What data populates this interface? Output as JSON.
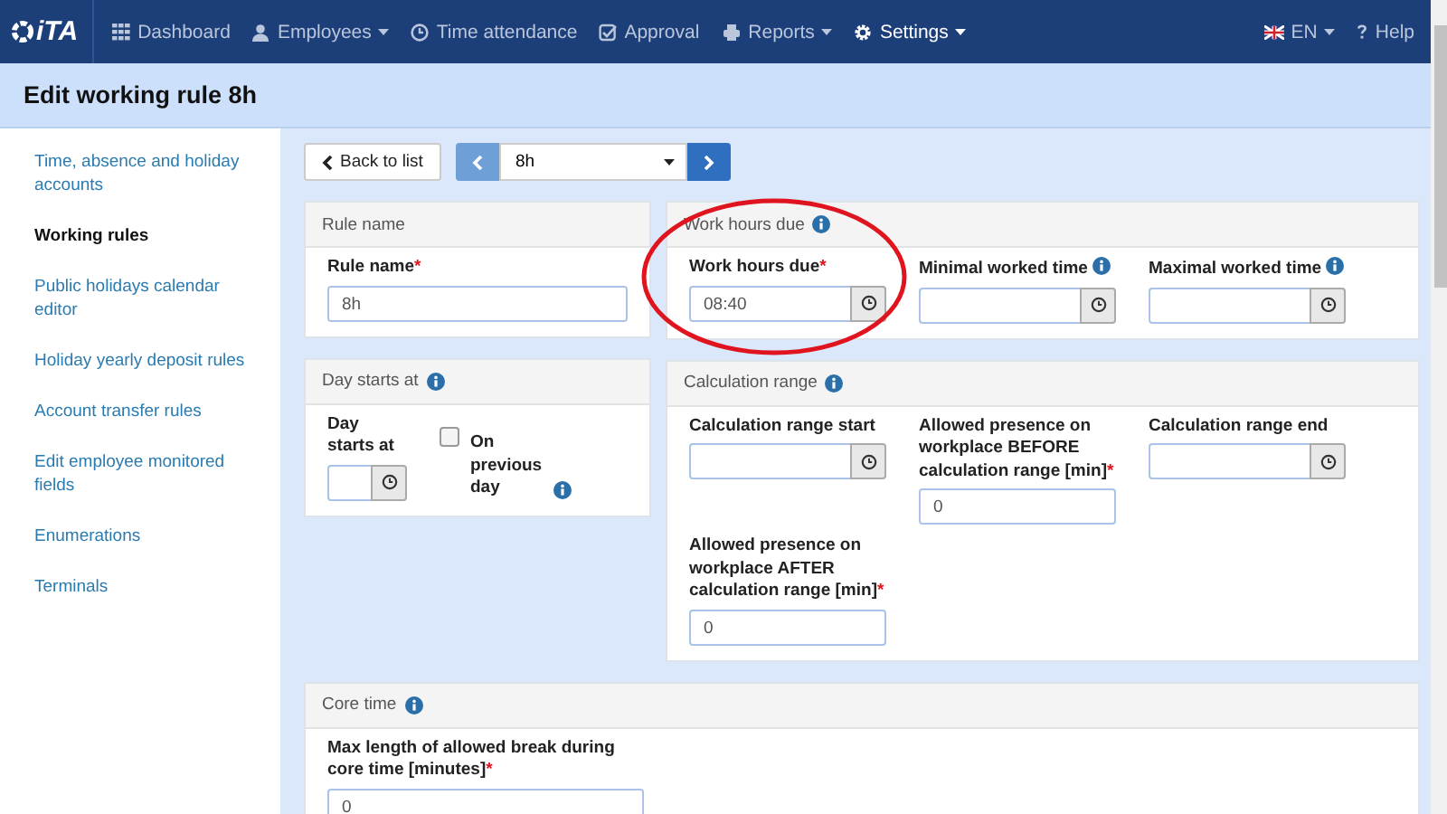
{
  "navbar": {
    "logo": "iTA",
    "items": [
      {
        "label": "Dashboard",
        "caret": false,
        "selected": false
      },
      {
        "label": "Employees",
        "caret": true,
        "selected": false
      },
      {
        "label": "Time attendance",
        "caret": false,
        "selected": false
      },
      {
        "label": "Approval",
        "caret": false,
        "selected": false
      },
      {
        "label": "Reports",
        "caret": true,
        "selected": false
      },
      {
        "label": "Settings",
        "caret": true,
        "selected": true
      }
    ],
    "language": "EN",
    "help": "Help"
  },
  "page_title": "Edit working rule 8h",
  "sidebar": {
    "items": [
      {
        "label": "Time, absence and holiday accounts",
        "selected": false
      },
      {
        "label": "Working rules",
        "selected": true
      },
      {
        "label": "Public holidays calendar editor",
        "selected": false
      },
      {
        "label": "Holiday yearly deposit rules",
        "selected": false
      },
      {
        "label": "Account transfer rules",
        "selected": false
      },
      {
        "label": "Edit employee monitored fields",
        "selected": false
      },
      {
        "label": "Enumerations",
        "selected": false
      },
      {
        "label": "Terminals",
        "selected": false
      }
    ]
  },
  "toolbar": {
    "back": "Back to list",
    "rule_select": "8h"
  },
  "left_panels": [
    {
      "title": "Rule name",
      "info": false,
      "fields": [
        {
          "kind": "text",
          "label": "Rule name",
          "asterisk": "*",
          "info": false,
          "value": "8h"
        }
      ]
    },
    {
      "title": "Day starts at",
      "info": true,
      "fields": [
        {
          "kind": "time",
          "label": "Day starts at",
          "info": false
        },
        {
          "kind": "checkbox",
          "label": "On previous day",
          "info": true,
          "checked": false
        }
      ]
    }
  ],
  "right_panels": [
    {
      "title": "Work hours due",
      "info": true,
      "highlighted": true,
      "fields": [
        {
          "kind": "time",
          "label": "Work hours due",
          "asterisk": "*",
          "info": false,
          "value": "08:40"
        },
        {
          "kind": "time",
          "label": "Minimal worked time",
          "info": true
        },
        {
          "kind": "time",
          "label": "Maximal worked time",
          "info": true
        }
      ]
    },
    {
      "title": "Calculation range",
      "info": true,
      "highlighted": false,
      "fields": [
        {
          "kind": "time",
          "label": "Calculation range start",
          "info": false
        },
        {
          "kind": "text",
          "label": "Allowed presence on workplace BEFORE calculation range [min]",
          "asterisk": "*",
          "info": false,
          "value": "0"
        },
        {
          "kind": "time",
          "label": "Calculation range end",
          "info": false
        },
        {
          "kind": "text",
          "label": "Allowed presence on workplace AFTER calculation range [min]",
          "asterisk": "*",
          "info": false,
          "value": "0"
        }
      ]
    }
  ],
  "full_panels": [
    {
      "title": "Core time",
      "info": true,
      "fields": [
        {
          "kind": "text",
          "label": "Max length of allowed break during core time [minutes]",
          "asterisk": "*",
          "info": false,
          "value": "0"
        }
      ]
    }
  ]
}
